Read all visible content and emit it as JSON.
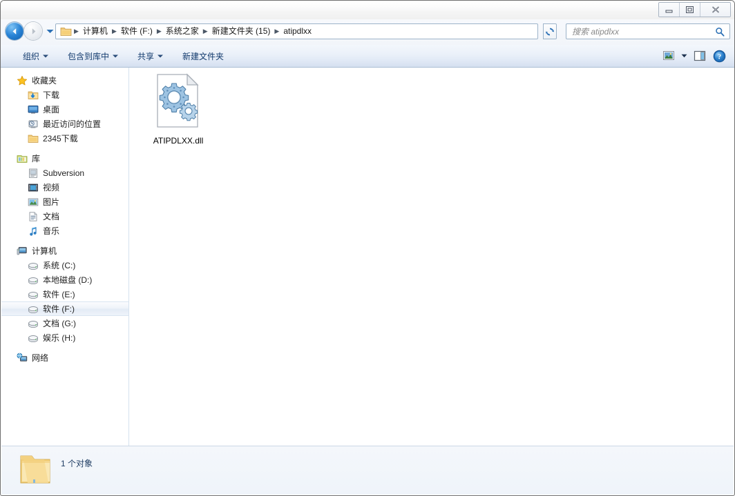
{
  "window": {
    "buttons": {
      "minimize": "minimize",
      "maximize": "maximize",
      "close": "close"
    }
  },
  "address": {
    "back_icon": "back-arrow-icon",
    "forward_icon": "forward-arrow-icon",
    "history_dropdown_icon": "chevron-down-icon",
    "folder_icon": "folder-icon",
    "breadcrumbs": [
      {
        "label": "计算机"
      },
      {
        "label": "软件 (F:)"
      },
      {
        "label": "系统之家"
      },
      {
        "label": "新建文件夹 (15)"
      },
      {
        "label": "atipdlxx"
      }
    ],
    "separator": "▸",
    "dropdown_icon": "chevron-down-icon",
    "refresh_icon": "refresh-icon"
  },
  "search": {
    "placeholder": "搜索 atipdlxx",
    "icon": "search-icon"
  },
  "toolbar": {
    "items": [
      {
        "label": "组织",
        "has_caret": true
      },
      {
        "label": "包含到库中",
        "has_caret": true
      },
      {
        "label": "共享",
        "has_caret": true
      },
      {
        "label": "新建文件夹",
        "has_caret": false
      }
    ],
    "right_icons": [
      {
        "name": "view-mode-icon"
      },
      {
        "name": "chevron-down-icon"
      },
      {
        "name": "preview-pane-icon"
      },
      {
        "name": "help-icon"
      }
    ]
  },
  "sidebar": {
    "groups": [
      {
        "header": {
          "label": "收藏夹",
          "icon": "star-icon"
        },
        "items": [
          {
            "label": "下载",
            "icon": "downloads-folder-icon"
          },
          {
            "label": "桌面",
            "icon": "desktop-icon"
          },
          {
            "label": "最近访问的位置",
            "icon": "recent-places-icon"
          },
          {
            "label": "2345下载",
            "icon": "folder-icon"
          }
        ]
      },
      {
        "header": {
          "label": "库",
          "icon": "library-icon"
        },
        "items": [
          {
            "label": "Subversion",
            "icon": "subversion-icon"
          },
          {
            "label": "视频",
            "icon": "video-icon"
          },
          {
            "label": "图片",
            "icon": "pictures-icon"
          },
          {
            "label": "文档",
            "icon": "documents-icon"
          },
          {
            "label": "音乐",
            "icon": "music-icon"
          }
        ]
      },
      {
        "header": {
          "label": "计算机",
          "icon": "computer-icon"
        },
        "items": [
          {
            "label": "系统 (C:)",
            "icon": "drive-icon",
            "selected": false
          },
          {
            "label": "本地磁盘 (D:)",
            "icon": "drive-icon",
            "selected": false
          },
          {
            "label": "软件 (E:)",
            "icon": "drive-icon",
            "selected": false
          },
          {
            "label": "软件 (F:)",
            "icon": "drive-icon",
            "selected": true
          },
          {
            "label": "文档 (G:)",
            "icon": "drive-icon",
            "selected": false
          },
          {
            "label": "娱乐 (H:)",
            "icon": "drive-icon",
            "selected": false
          }
        ]
      },
      {
        "header": {
          "label": "网络",
          "icon": "network-icon"
        },
        "items": []
      }
    ]
  },
  "content": {
    "files": [
      {
        "name": "ATIPDLXX.dll",
        "icon": "dll-file-icon"
      }
    ]
  },
  "status": {
    "icon": "folder-icon",
    "text": "1 个对象"
  },
  "colors": {
    "accent": "#2a84d6",
    "toolbar_text": "#123a6d",
    "status_text": "#1f3d63",
    "window_border": "#6e6e6e"
  }
}
